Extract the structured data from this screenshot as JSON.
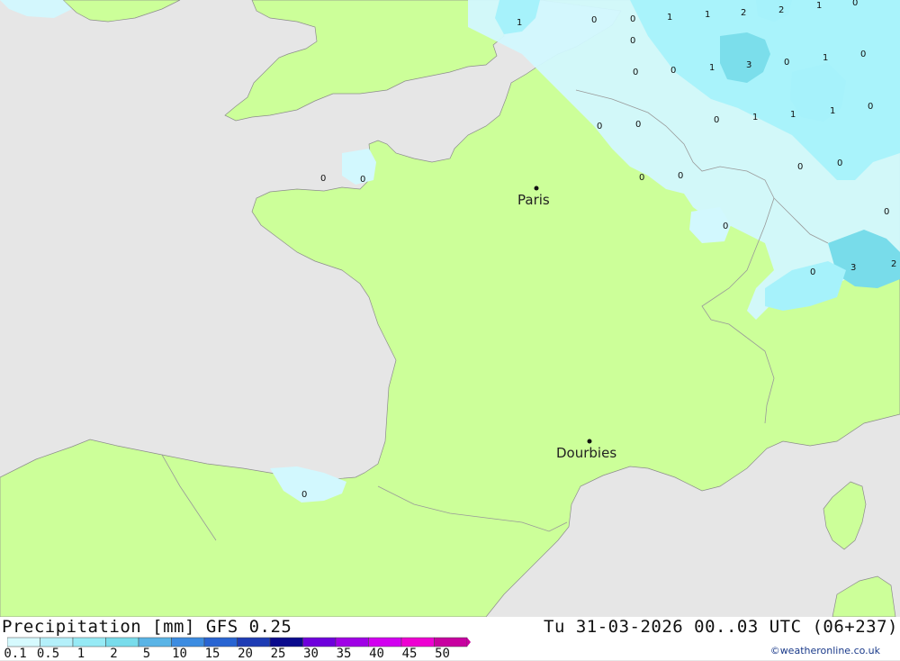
{
  "map": {
    "places": [
      {
        "name": "Paris"
      },
      {
        "name": "Dourbies"
      }
    ],
    "precip_values": [
      "1",
      "0",
      "0",
      "1",
      "1",
      "2",
      "2",
      "1",
      "0",
      "0",
      "0",
      "0",
      "1",
      "3",
      "0",
      "1",
      "0",
      "0",
      "0",
      "1",
      "1",
      "1",
      "0",
      "0",
      "0",
      "0",
      "0",
      "0",
      "0",
      "0",
      "0",
      "0",
      "3",
      "2",
      "0"
    ]
  },
  "footer": {
    "title": "Precipitation [mm] GFS 0.25",
    "datetime": "Tu 31-03-2026 00..03 UTC (06+237)",
    "credit": "©weatheronline.co.uk"
  },
  "legend": {
    "ticks": [
      "0.1",
      "0.5",
      "1",
      "2",
      "5",
      "10",
      "15",
      "20",
      "25",
      "30",
      "35",
      "40",
      "45",
      "50"
    ],
    "colors": [
      "#d6fafe",
      "#b4f0fa",
      "#96eaf5",
      "#78dceb",
      "#5ab4e6",
      "#3c8ce1",
      "#2864d2",
      "#1e3cb4",
      "#0a0a8c",
      "#6e00dc",
      "#a000e6",
      "#d200f0",
      "#ee00d2",
      "#c800a0"
    ]
  },
  "colors": {
    "sea": "#e6e6e6",
    "land": "#ccff99",
    "border": "#999999",
    "precip_light": "#d2f8fe",
    "precip_mid": "#a6f2fb",
    "precip_heavy": "#78dcea"
  }
}
